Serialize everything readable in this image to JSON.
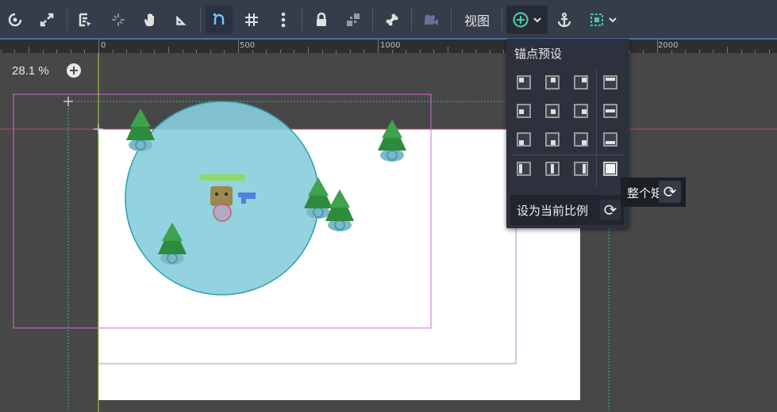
{
  "toolbar": {
    "view_label": "视图",
    "colors": {
      "background": "#363d4a",
      "accent": "#4f6c99",
      "active_icon": "#6fc3ff",
      "anchor_accent": "#45c8a8"
    }
  },
  "ruler": {
    "labels": [
      "0",
      "500",
      "1000",
      "1500",
      "2000"
    ]
  },
  "zoom": {
    "value": "28.1 %"
  },
  "anchor_menu": {
    "title": "锚点预设",
    "set_ratio_label": "设为当前比例"
  },
  "tooltip": {
    "text": "整个矩"
  },
  "icons": [
    "rotate-icon",
    "scale-icon",
    "select-list-icon",
    "pivot-icon",
    "pan-hand-icon",
    "ruler-icon",
    "snap-icon",
    "grid-snap-icon",
    "more-icon",
    "lock-icon",
    "group-icon",
    "bone-icon",
    "camera-icon",
    "anchor-icon",
    "anchor-preset-icon",
    "frame-icon"
  ]
}
